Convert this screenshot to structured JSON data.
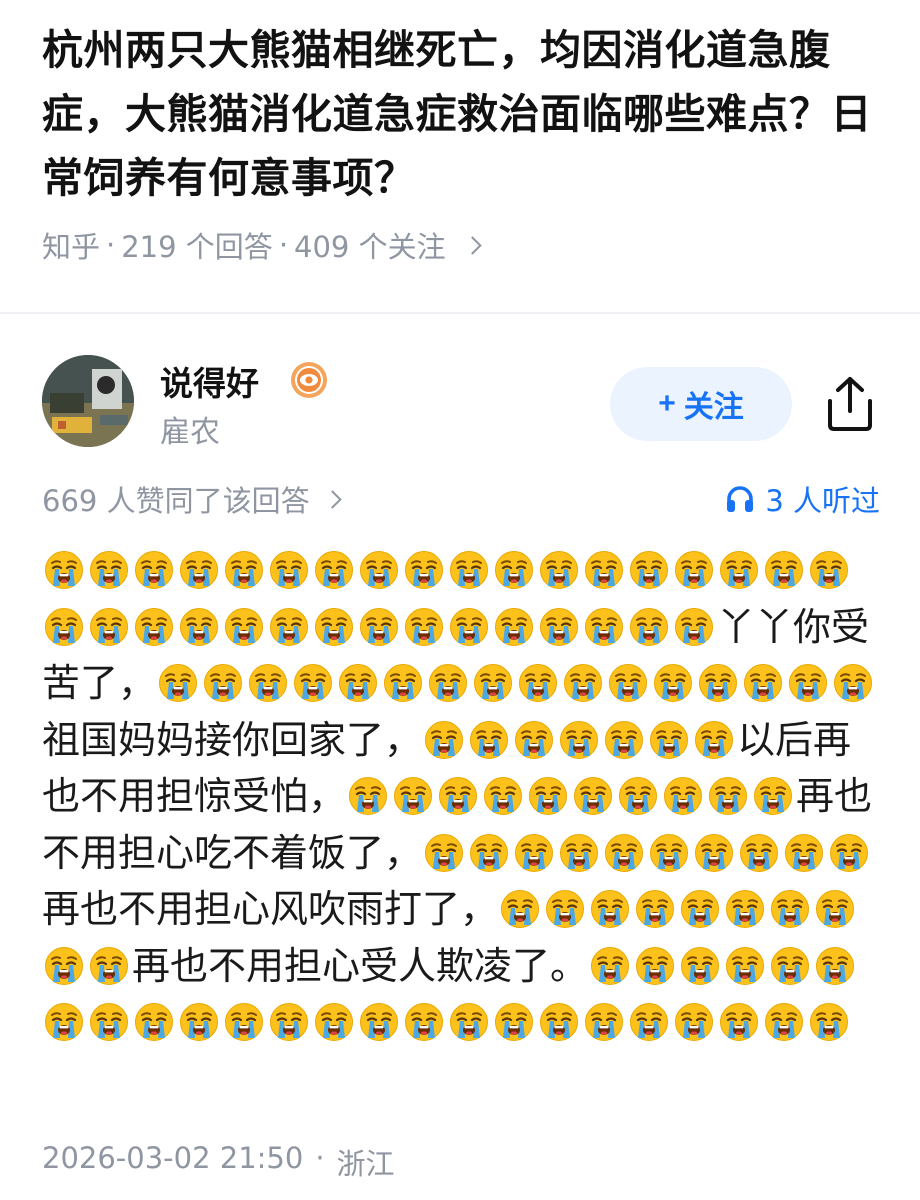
{
  "question": {
    "title": "杭州两只大熊猫相继死亡，均因消化道急腹症，大熊猫消化道急症救治面临哪些难点？日常饲养有何意事项？",
    "source": "知乎",
    "answer_count": "219 个回答",
    "follow_count": "409 个关注"
  },
  "author": {
    "name": "说得好",
    "subtitle": "雇农",
    "follow_label": "关注",
    "follow_plus": "+",
    "icons": {
      "badge": "eye-badge-icon",
      "share": "share-icon",
      "listen": "headphones-icon"
    }
  },
  "stats": {
    "likes": "669 人赞同了该回答",
    "listeners": "3 人听过"
  },
  "content": {
    "emoji_name": "loudly-crying-face",
    "segments": [
      {
        "emoji": 33,
        "text": "丫丫你受苦了，"
      },
      {
        "emoji": 16,
        "text": "祖国妈妈接你回家了，"
      },
      {
        "emoji": 7,
        "text": "以后再也不用担惊受怕，"
      },
      {
        "emoji": 10,
        "text": "再也不用担心吃不着饭了，"
      },
      {
        "emoji": 10,
        "text": "再也不用担心风吹雨打了，"
      },
      {
        "emoji": 10,
        "text": "再也不用担心受人欺凌了。"
      },
      {
        "emoji": 24,
        "text": ""
      }
    ]
  },
  "footer": {
    "datetime": "2026-03-02 21:50",
    "location": "浙江"
  },
  "colors": {
    "accent": "#1772f6",
    "meta_gray": "#8f96a1",
    "follow_bg": "#ebf3ff"
  }
}
